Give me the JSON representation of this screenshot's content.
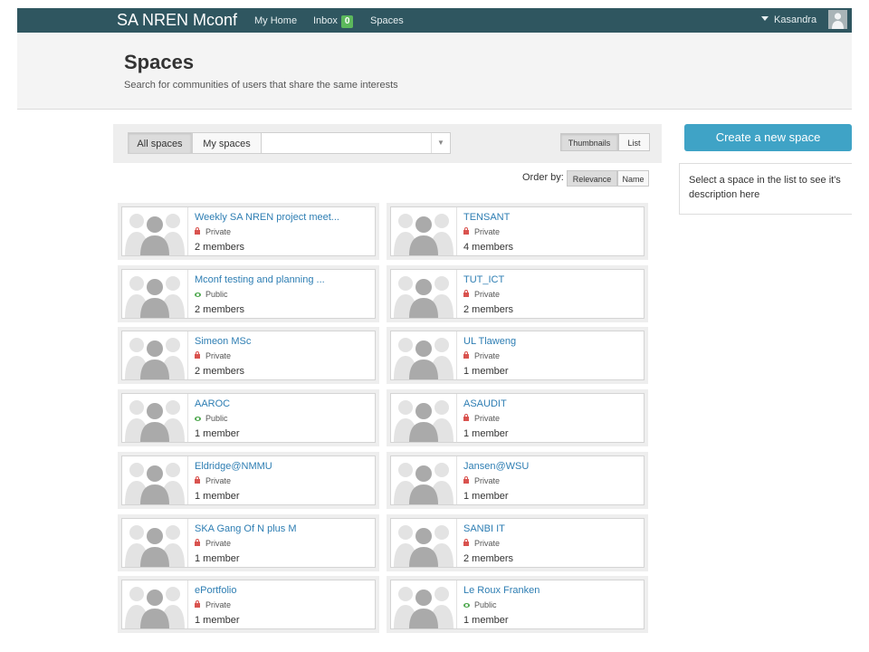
{
  "topbar": {
    "brand": "SA NREN Mconf",
    "nav": [
      {
        "label": "My Home"
      },
      {
        "label": "Inbox",
        "badge": "0"
      },
      {
        "label": "Spaces"
      }
    ],
    "user": "Kasandra"
  },
  "header": {
    "title": "Spaces",
    "subtitle": "Search for communities of users that share the same interests"
  },
  "filters": {
    "all_spaces": "All spaces",
    "my_spaces": "My spaces",
    "search_value": "",
    "view_thumbnails": "Thumbnails",
    "view_list": "List",
    "order_label": "Order by:",
    "order_relevance": "Relevance",
    "order_name": "Name"
  },
  "sidebar": {
    "create_button": "Create a new space",
    "description": "Select a space in the list to see it's description here"
  },
  "spaces": [
    {
      "name": "Weekly SA NREN project meet...",
      "visibility": "Private",
      "members": "2 members"
    },
    {
      "name": "TENSANT",
      "visibility": "Private",
      "members": "4 members"
    },
    {
      "name": "Mconf testing and planning ...",
      "visibility": "Public",
      "members": "2 members"
    },
    {
      "name": "TUT_ICT",
      "visibility": "Private",
      "members": "2 members"
    },
    {
      "name": "Simeon MSc",
      "visibility": "Private",
      "members": "2 members"
    },
    {
      "name": "UL Tlaweng",
      "visibility": "Private",
      "members": "1 member"
    },
    {
      "name": "AAROC",
      "visibility": "Public",
      "members": "1 member"
    },
    {
      "name": "ASAUDIT",
      "visibility": "Private",
      "members": "1 member"
    },
    {
      "name": "Eldridge@NMMU",
      "visibility": "Private",
      "members": "1 member"
    },
    {
      "name": "Jansen@WSU",
      "visibility": "Private",
      "members": "1 member"
    },
    {
      "name": "SKA Gang Of N plus M",
      "visibility": "Private",
      "members": "1 member"
    },
    {
      "name": "SANBI IT",
      "visibility": "Private",
      "members": "2 members"
    },
    {
      "name": "ePortfolio",
      "visibility": "Private",
      "members": "1 member"
    },
    {
      "name": "Le Roux Franken",
      "visibility": "Public",
      "members": "1 member"
    }
  ]
}
